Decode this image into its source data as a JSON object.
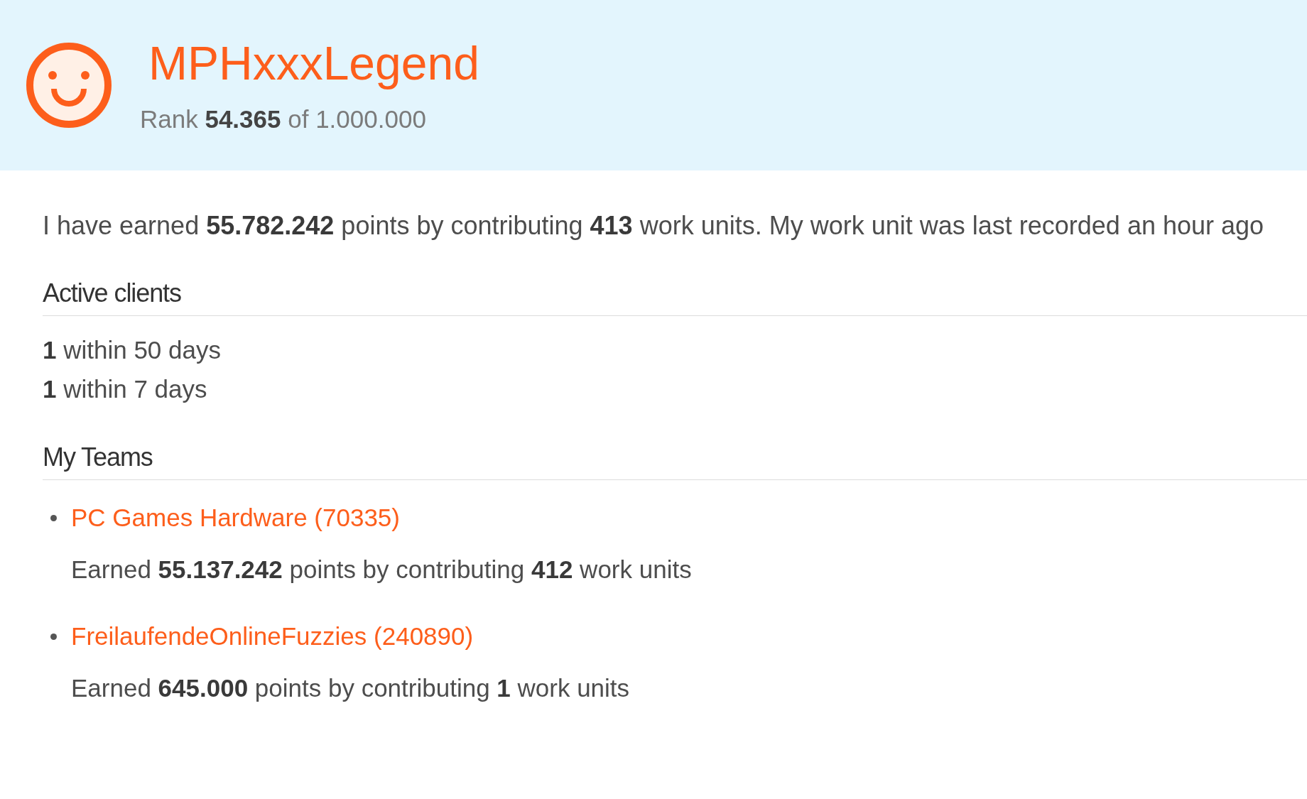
{
  "profile": {
    "name": "MPHxxxLegend",
    "rank": "Rank **54.365** of 1.000.000"
  },
  "summary": "I have earned **55.782.242** points by contributing **413** work units. My work unit was last recorded an hour ago",
  "active_clients": {
    "heading": "Active clients",
    "items": [
      "**1** within 50 days",
      "**1** within 7 days"
    ]
  },
  "teams": {
    "heading": "My Teams",
    "items": [
      {
        "name": "PC Games Hardware (70335)",
        "summary": "Earned **55.137.242** points by contributing **412** work units"
      },
      {
        "name": "FreilaufendeOnlineFuzzies (240890)",
        "summary": "Earned **645.000** points by contributing **1** work units"
      }
    ]
  }
}
